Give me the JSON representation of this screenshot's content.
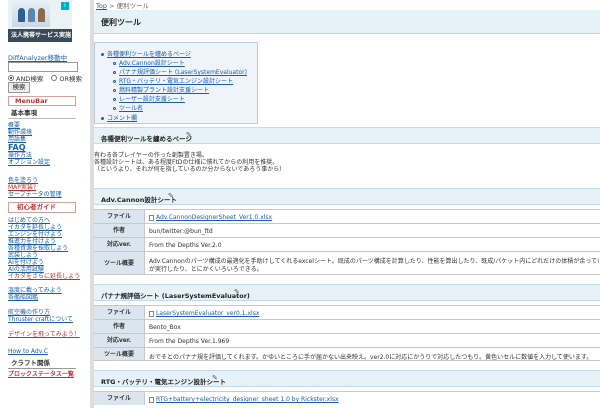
{
  "sidebar": {
    "ad": {
      "caption": "法人携帯サービス実施中",
      "info": "i"
    },
    "diff_link": "DiffAnalyzer移動中",
    "search": {
      "placeholder": "",
      "and_label": "AND検索",
      "or_label": "OR検索",
      "button": "検索"
    },
    "menubar": "MenuBar",
    "basic_head": "基本事項",
    "basic_items": [
      "概要",
      "動作環境",
      "用語集",
      "FAQ",
      "操作方法",
      "オプション設定"
    ],
    "misc_items": [
      "色を塗ろう",
      "MAP実装?",
      "セーブデータの管理"
    ],
    "guide_head": "初心者ガイド",
    "guide_items": [
      "はじめての方へ",
      "イカダを延長しよう",
      "エンジンを付けよう",
      "推進力を付けよう",
      "各種資源を採取しよう",
      "武装しよう",
      "AIを付けよう",
      "AIの活用試験",
      "イカダをさらに延長しよう"
    ],
    "misc2_items": [
      "温度に載ってみよう",
      "各艦船図鑑"
    ],
    "misc3_items": [
      "航空機の作り方",
      "Thruster craftについて"
    ],
    "design_item": "デザインを飛ってみよう！",
    "howto_item": "How to Adv.C",
    "craft_head": "クラフト関係",
    "block_item": "ブロックステータス一覧"
  },
  "main": {
    "breadcrumb": {
      "top": "Top",
      "sep": ">",
      "current": "便利ツール"
    },
    "title": "便利ツール",
    "toc": [
      {
        "label": "各種便利ツールを纏めるページ",
        "level": 0
      },
      {
        "label": "Adv.Cannon設計シート",
        "level": 1
      },
      {
        "label": "パナナ規評価シート (LaserSystemEvaluator)",
        "level": 1
      },
      {
        "label": "RTG・バッテリ・電気エンジン設計シート",
        "level": 1
      },
      {
        "label": "燃料精製プラント設計支援シート",
        "level": 1
      },
      {
        "label": "レーザー設計支援シート",
        "level": 1
      },
      {
        "label": "ツール名",
        "level": 1
      },
      {
        "label": "コメント欄",
        "level": 0
      }
    ],
    "intro": {
      "heading": "各種便利ツールを纏めるページ",
      "lines": [
        "有わる各プレイヤーの作った創製置き場。",
        "各種設計シートは、ある程度FtDの仕様に慣れてからの利用を推奨。",
        "（というより、それが何を指しているのか分からないであろう事から）"
      ]
    },
    "sections": [
      {
        "heading": "Adv.Cannon設計シート",
        "rows": [
          {
            "key": "ファイル",
            "value": "Adv.CannonDesignerSheet_Ver1.0.xlsx",
            "link": true
          },
          {
            "key": "作者",
            "value": "bun/twitter:@bun_ftd",
            "link": false
          },
          {
            "key": "対応ver.",
            "value": "From the Depths Ver.2.0",
            "link": false
          },
          {
            "key": "ツール概要",
            "value": "Adv.Cannonのパーツ構成の最適化を手助けしてくれるexcelシート。既成のパーツ構成を計算したり、性能を算出したり、既成/パケット内にどれだけの体積が余っているか",
            "value2": "が実行したり、とにかくいろいろできる。",
            "link": false
          }
        ]
      },
      {
        "heading": "パナナ規評価シート (LaserSystemEvaluator)",
        "rows": [
          {
            "key": "ファイル",
            "value": "LaserSystemEvaluator_ver0.1.xlsx",
            "link": true
          },
          {
            "key": "作者",
            "value": "Bento_Box",
            "link": false
          },
          {
            "key": "対応ver.",
            "value": "From the Depths Ver.1.969",
            "link": false
          },
          {
            "key": "ツール概要",
            "value": "おでそとのパナナ規を評価してくれます。かゆいところに手が届かない出来映え。ver2.0に対応にかうりで対応したつもり。黄色いセルに数値を入力して使います。",
            "link": false
          }
        ]
      },
      {
        "heading": "RTG・バッテリ・電気エンジン設計シート",
        "rows": [
          {
            "key": "ファイル",
            "value": "RTG+battery+electricity_designer_sheet 1.0 by Rickster.xlsx",
            "link": true
          }
        ]
      }
    ]
  }
}
